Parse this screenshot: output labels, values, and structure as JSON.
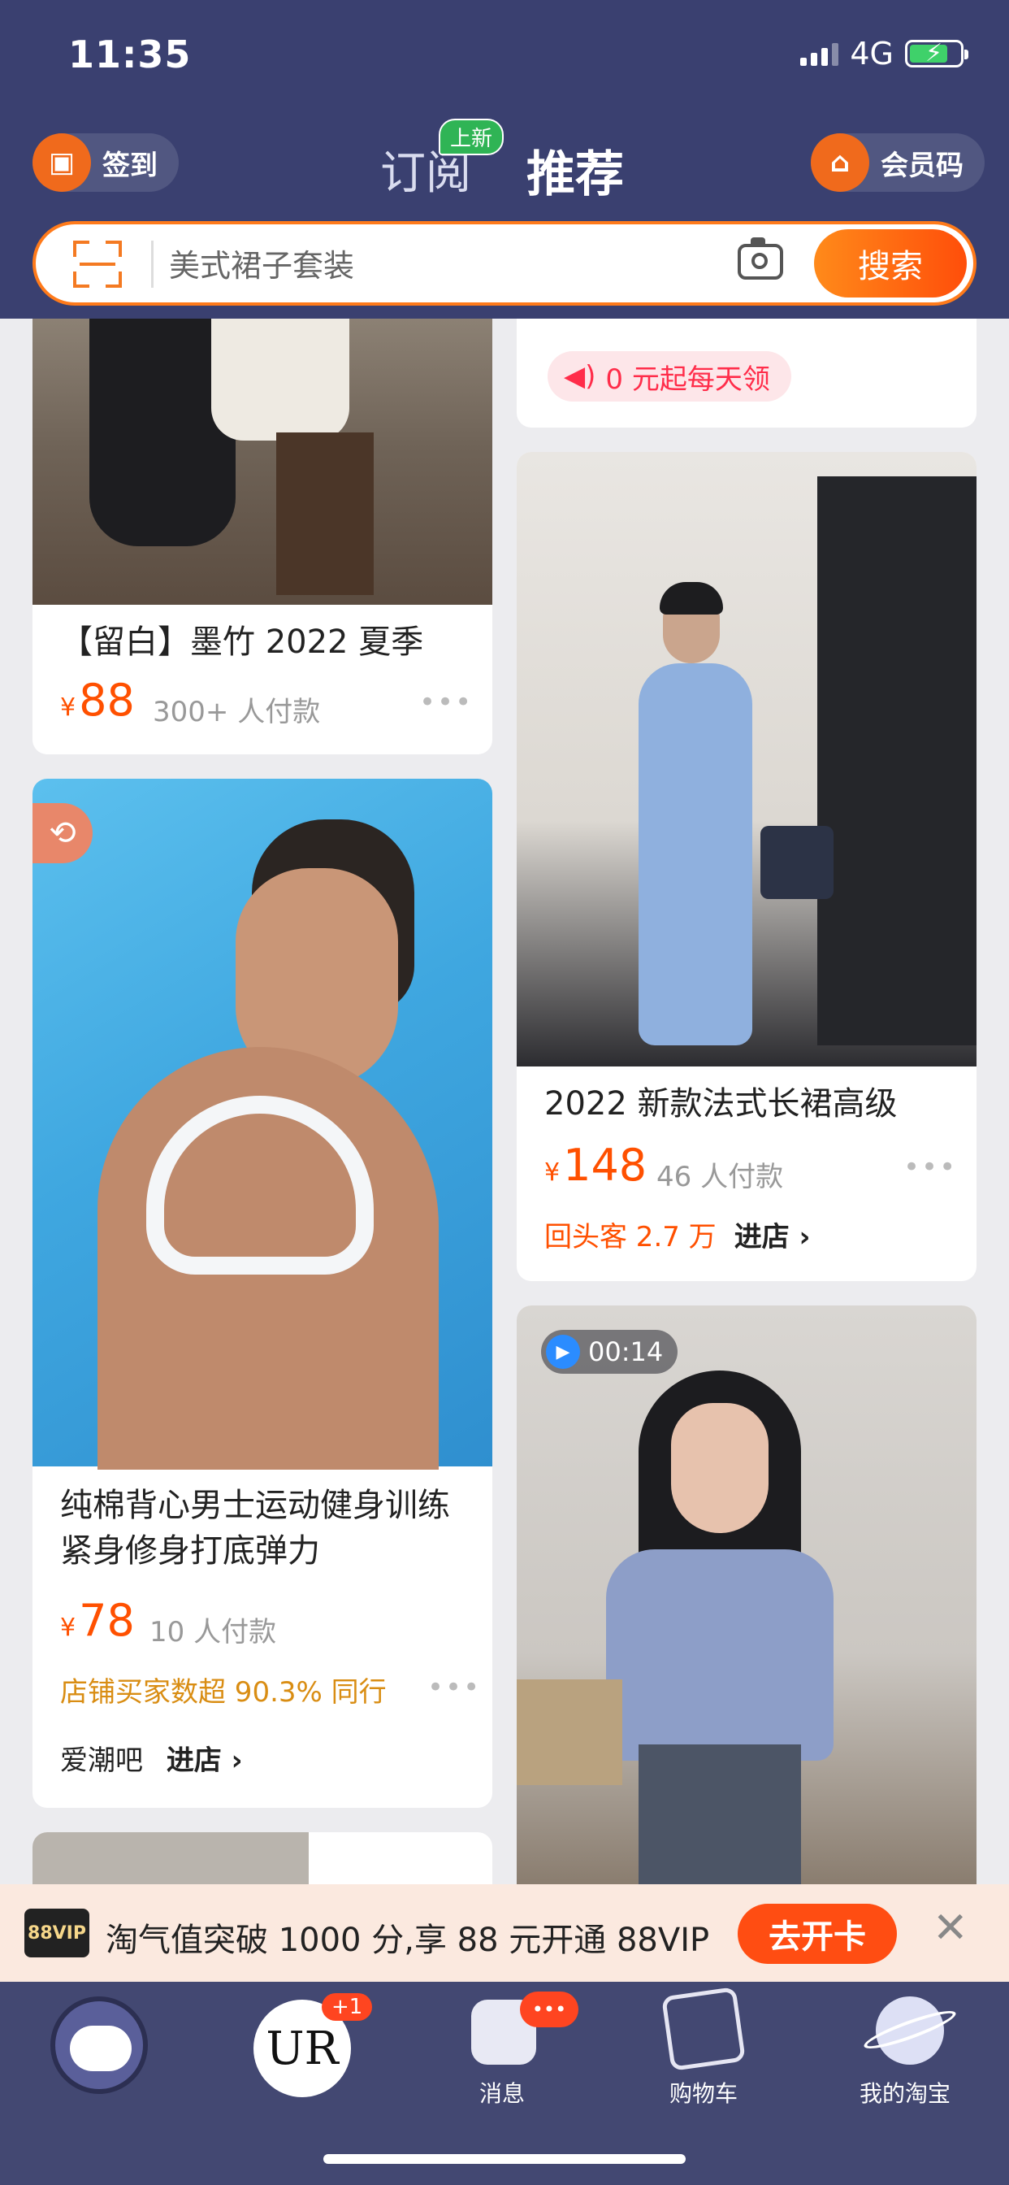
{
  "status_bar": {
    "time": "11:35",
    "network": "4G"
  },
  "header": {
    "checkin_label": "签到",
    "tab_subscribe": "订阅",
    "tab_subscribe_badge": "上新",
    "tab_recommend": "推荐",
    "member_code_label": "会员码"
  },
  "search": {
    "placeholder": "美式裙子套装",
    "button_label": "搜索"
  },
  "feed": {
    "left": [
      {
        "title": "【留白】墨竹 2022 夏季",
        "currency": "¥",
        "price": "88",
        "sales": "300+ 人付款",
        "more": "•••"
      },
      {
        "title": "纯棉背心男士运动健身训练紧身修身打底弹力",
        "currency": "¥",
        "price": "78",
        "sales": "10 人付款",
        "tag": "店铺买家数超 90.3% 同行",
        "more": "•••",
        "shop": "爱潮吧",
        "enter_shop": "进店 ›"
      }
    ],
    "right": [
      {
        "coupon": "0 元起每天领"
      },
      {
        "title": "2022 新款法式长裙高级",
        "currency": "¥",
        "price": "148",
        "sales": "46 人付款",
        "more": "•••",
        "repeat_buyers": "回头客 2.7 万",
        "enter_shop": "进店 ›"
      },
      {
        "video_duration": "00:14"
      }
    ]
  },
  "vip_banner": {
    "logo": "88VIP",
    "text": "淘气值突破 1000 分,享 88 元开通 88VIP",
    "button": "去开卡",
    "close": "✕"
  },
  "tabbar": {
    "badge_plus": "+1",
    "badge_dots": "•••",
    "messages": "消息",
    "cart": "购物车",
    "my_taobao": "我的淘宝"
  },
  "colors": {
    "header_bg": "#3a4070",
    "accent_orange": "#ff5000",
    "tabbar_bg": "#434872"
  }
}
